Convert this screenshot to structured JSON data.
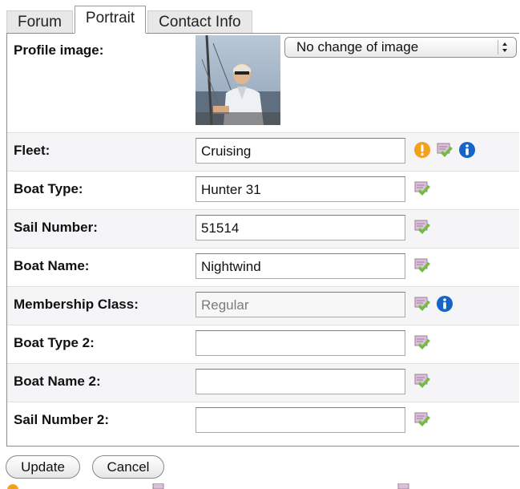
{
  "tabs": [
    {
      "label": "Forum"
    },
    {
      "label": "Portrait",
      "active": true
    },
    {
      "label": "Contact Info"
    }
  ],
  "profile_image": {
    "label": "Profile image:",
    "select_value": "No change of image"
  },
  "fields": [
    {
      "label": "Fleet:",
      "value": "Cruising",
      "icons": [
        "warning-icon",
        "edit-icon",
        "info-icon"
      ]
    },
    {
      "label": "Boat Type:",
      "value": "Hunter 31",
      "icons": [
        "edit-icon"
      ]
    },
    {
      "label": "Sail Number:",
      "value": "51514",
      "icons": [
        "edit-icon"
      ]
    },
    {
      "label": "Boat Name:",
      "value": "Nightwind",
      "icons": [
        "edit-icon"
      ]
    },
    {
      "label": "Membership Class:",
      "value": "Regular",
      "disabled": true,
      "icons": [
        "edit-icon",
        "info-icon"
      ]
    },
    {
      "label": "Boat Type 2:",
      "value": "",
      "icons": [
        "edit-icon"
      ]
    },
    {
      "label": "Boat Name 2:",
      "value": "",
      "icons": [
        "edit-icon"
      ]
    },
    {
      "label": "Sail Number 2:",
      "value": "",
      "icons": [
        "edit-icon"
      ]
    }
  ],
  "buttons": {
    "update": "Update",
    "cancel": "Cancel"
  },
  "colors": {
    "warning": "#f2a11d",
    "info": "#1565c8",
    "edit_green": "#6fbf3a",
    "edit_paper": "#d9c2d6"
  }
}
